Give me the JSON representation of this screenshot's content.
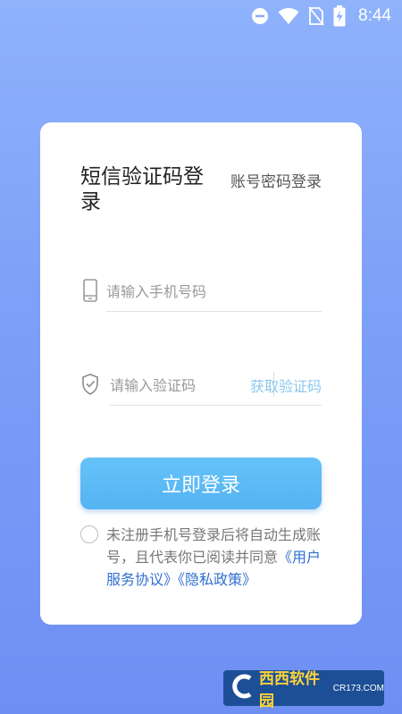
{
  "status_bar": {
    "time": "8:44",
    "icons": [
      "do-not-disturb-icon",
      "wifi-icon",
      "no-sim-icon",
      "battery-charging-icon"
    ]
  },
  "login": {
    "title": "短信验证码登录",
    "switch_label": "账号密码登录",
    "phone_placeholder": "请输入手机号码",
    "phone_value": "",
    "code_placeholder": "请输入验证码",
    "code_value": "",
    "get_code_label": "获取验证码",
    "submit_label": "立即登录",
    "agreement_prefix": "未注册手机号登录后将自动生成账号，且代表你已阅读并同意",
    "user_agreement": "《用户服务协议》",
    "privacy_policy": "《隐私政策》",
    "agreement_checked": false
  },
  "colors": {
    "background_top": "#8fb2fb",
    "background_bottom": "#6e8ff4",
    "button": "#5ab8f5",
    "link": "#2f6fd1",
    "get_code": "#8cc8ee"
  },
  "watermark": {
    "brand": "西西软件园",
    "url": "CR173.COM"
  }
}
